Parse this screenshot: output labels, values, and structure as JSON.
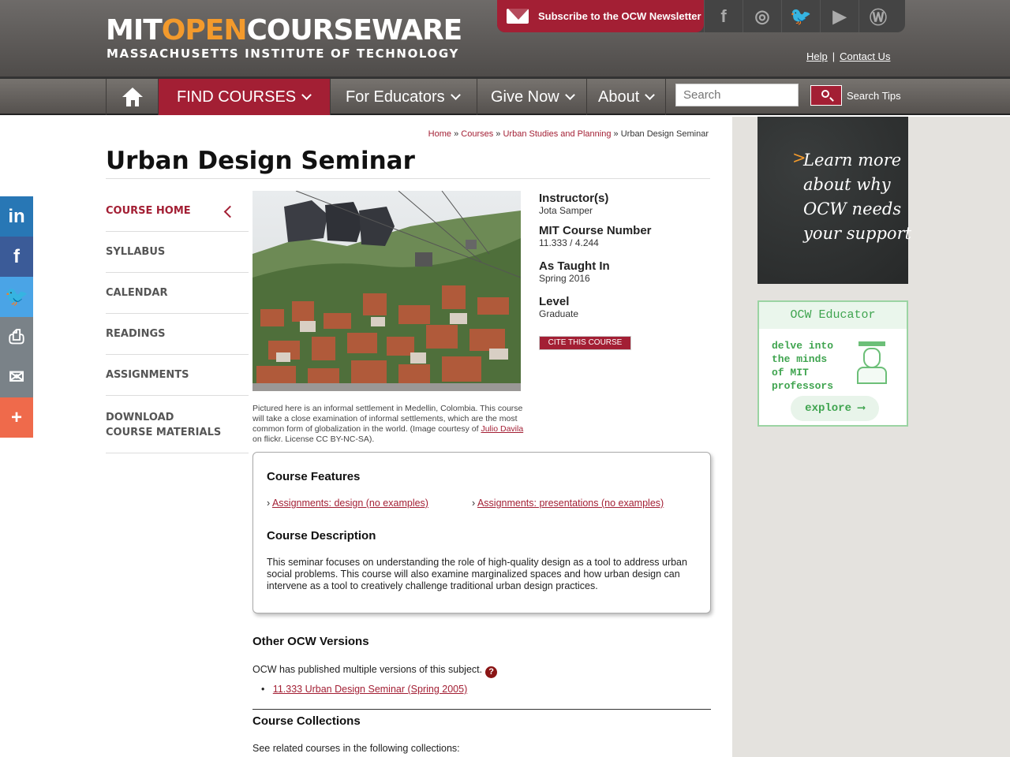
{
  "header": {
    "logo_mit": "MIT",
    "logo_open": "OPEN",
    "logo_courseware": "COURSEWARE",
    "logo_sub": "MASSACHUSETTS INSTITUTE OF TECHNOLOGY",
    "subscribe_label": "Subscribe to the OCW Newsletter",
    "social": [
      "facebook-icon",
      "instagram-icon",
      "twitter-icon",
      "youtube-icon",
      "wordpress-icon"
    ],
    "help_label": "Help",
    "help_sep": "|",
    "contact_label": "Contact Us"
  },
  "nav": {
    "find_courses": "FIND COURSES",
    "for_educators": "For Educators",
    "give_now": "Give Now",
    "about": "About",
    "search_placeholder": "Search",
    "search_tips": "Search Tips"
  },
  "breadcrumb": {
    "home": "Home",
    "courses": "Courses",
    "dept": "Urban Studies and Planning",
    "current": "Urban Design Seminar",
    "sep": "»"
  },
  "page_title": "Urban Design Seminar",
  "course_nav": [
    {
      "label": "COURSE HOME",
      "active": true
    },
    {
      "label": "SYLLABUS"
    },
    {
      "label": "CALENDAR"
    },
    {
      "label": "READINGS"
    },
    {
      "label": "ASSIGNMENTS"
    },
    {
      "label": "DOWNLOAD COURSE MATERIALS"
    }
  ],
  "caption": {
    "text_before": "Pictured here is an informal settlement in Medellin, Colombia. This course will take a close examination of informal settlements, which are the most common form of globalization in the world. (Image courtesy of",
    "link": "Julio Davila",
    "text_after": "on flickr. License CC BY-NC-SA)."
  },
  "info": {
    "instructor_label": "Instructor(s)",
    "instructor": "Jota Samper",
    "number_label": "MIT Course Number",
    "number": "11.333 / 4.244",
    "taught_label": "As Taught In",
    "taught": "Spring 2016",
    "level_label": "Level",
    "level": "Graduate",
    "cite": "CITE THIS COURSE"
  },
  "features": {
    "heading": "Course Features",
    "link1": "Assignments: design (no examples)",
    "link2": "Assignments: presentations (no examples)",
    "desc_heading": "Course Description",
    "description": "This seminar focuses on understanding the role of high-quality design as a tool to address urban social problems. This course will also examine marginalized spaces and how urban design can intervene as a tool to creatively challenge traditional urban design practices."
  },
  "other_versions": {
    "heading": "Other OCW Versions",
    "text": "OCW has published multiple versions of this subject.",
    "help_icon": "?",
    "link": "11.333 Urban Design Seminar (Spring 2005)"
  },
  "collections": {
    "heading": "Course Collections",
    "text": "See related courses in the following collections:"
  },
  "sidebar": {
    "chalk_text": "Learn more\nabout why\nOCW needs\nyour support",
    "chalk_arrow": ">",
    "educator_title": "OCW Educator",
    "educator_text": "delve into\nthe minds\nof MIT\nprofessors",
    "explore": "explore ⟶"
  },
  "share": [
    {
      "icon": "linkedin-icon",
      "glyph": "in",
      "color": "#2877b5"
    },
    {
      "icon": "facebook-icon",
      "glyph": "f",
      "color": "#3b5b98"
    },
    {
      "icon": "twitter-icon",
      "glyph": "🐦",
      "color": "#4aa4e6"
    },
    {
      "icon": "print-icon",
      "glyph": "⎙",
      "color": "#7a8288"
    },
    {
      "icon": "email-icon",
      "glyph": "✉",
      "color": "#7a8288"
    },
    {
      "icon": "more-icon",
      "glyph": "+",
      "color": "#ef6a4b"
    }
  ],
  "colors": {
    "brand": "#a31f34",
    "orange": "#f39a2c",
    "green": "#3fa44f"
  }
}
